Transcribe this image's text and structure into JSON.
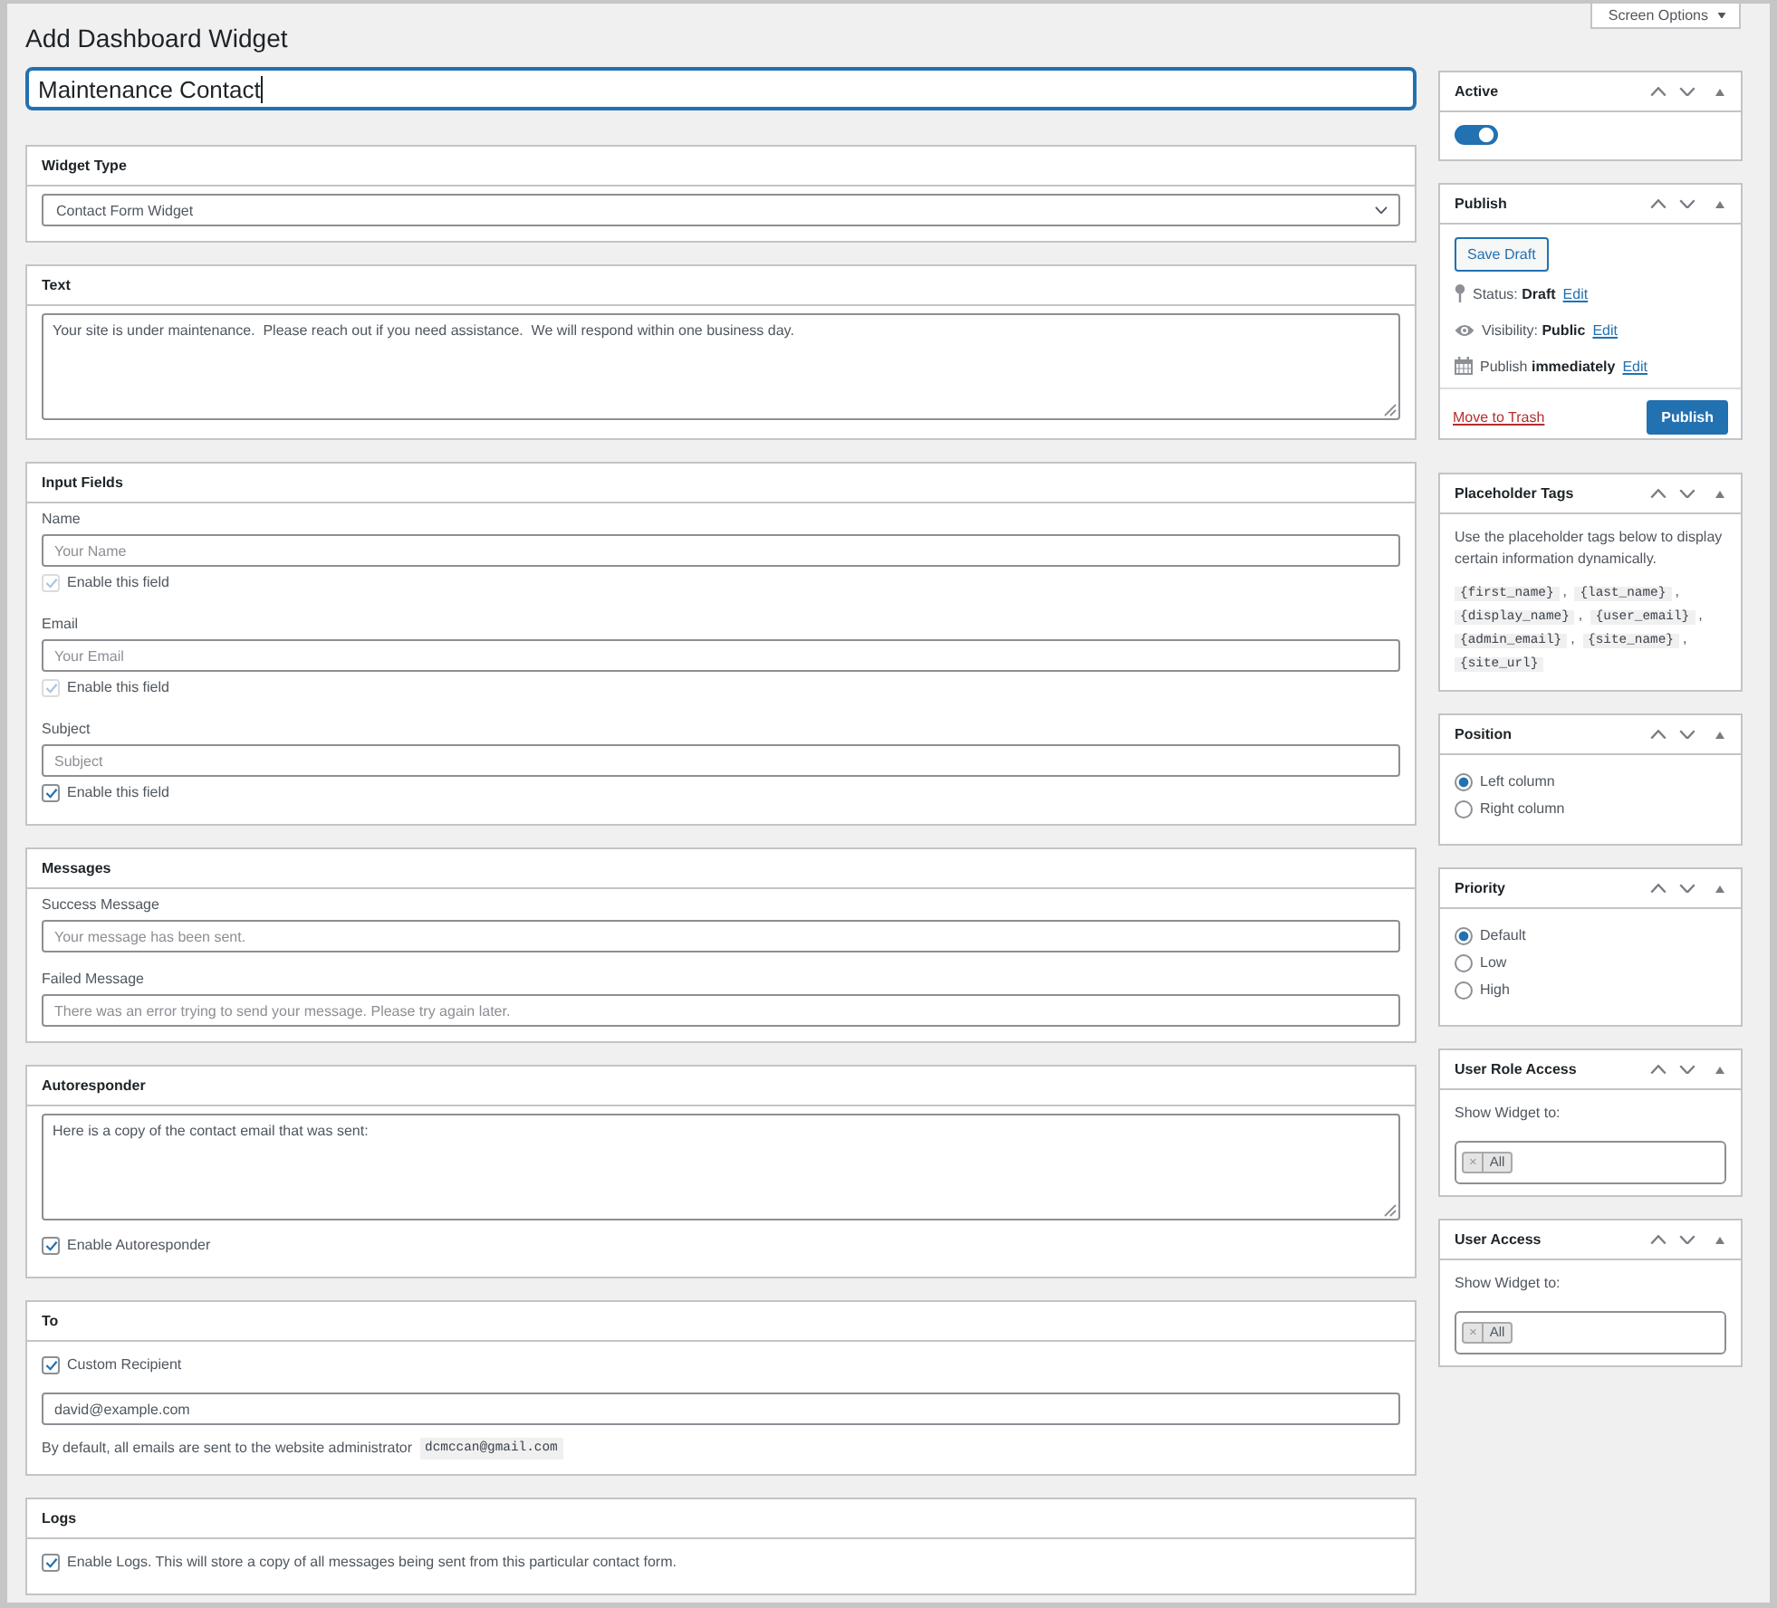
{
  "screen_options": {
    "label": "Screen Options"
  },
  "page_title": "Add Dashboard Widget",
  "title_field": {
    "value": "Maintenance Contact"
  },
  "main_boxes": [
    {
      "title": "Widget Type",
      "items": [
        {
          "kind": "select",
          "value": "Contact Form Widget"
        }
      ]
    },
    {
      "title": "Text",
      "items": [
        {
          "kind": "textarea",
          "value": "Your site is under maintenance.  Please reach out if you need assistance.  We will respond within one business day."
        }
      ]
    },
    {
      "title": "Input Fields",
      "items": [
        {
          "kind": "label",
          "text": "Name"
        },
        {
          "kind": "input",
          "placeholder": "Your Name"
        },
        {
          "kind": "checkbox",
          "label": "Enable this field",
          "checked": true,
          "disabled": true
        },
        {
          "kind": "label",
          "text": "Email"
        },
        {
          "kind": "input",
          "placeholder": "Your Email"
        },
        {
          "kind": "checkbox",
          "label": "Enable this field",
          "checked": true,
          "disabled": true
        },
        {
          "kind": "label",
          "text": "Subject"
        },
        {
          "kind": "input",
          "placeholder": "Subject"
        },
        {
          "kind": "checkbox",
          "label": "Enable this field",
          "checked": true,
          "disabled": false
        }
      ]
    },
    {
      "title": "Messages",
      "items": [
        {
          "kind": "label",
          "text": "Success Message"
        },
        {
          "kind": "input",
          "placeholder": "Your message has been sent."
        },
        {
          "kind": "label",
          "text": "Failed Message"
        },
        {
          "kind": "input",
          "placeholder": "There was an error trying to send your message. Please try again later."
        }
      ]
    },
    {
      "title": "Autoresponder",
      "items": [
        {
          "kind": "textarea",
          "value": "Here is a copy of the contact email that was sent:"
        },
        {
          "kind": "checkbox",
          "label": "Enable Autoresponder",
          "checked": true,
          "disabled": false
        }
      ]
    },
    {
      "title": "To",
      "items": [
        {
          "kind": "checkbox",
          "label": "Custom Recipient",
          "checked": true,
          "disabled": false
        },
        {
          "kind": "input",
          "value": "david@example.com"
        },
        {
          "kind": "note",
          "text": "By default, all emails are sent to the website administrator",
          "code": "dcmccan@gmail.com"
        }
      ]
    },
    {
      "title": "Logs",
      "items": [
        {
          "kind": "checkbox",
          "label": "Enable Logs. This will store a copy of all messages being sent from this particular contact form.",
          "checked": true,
          "disabled": false
        }
      ]
    }
  ],
  "sidebar_boxes": [
    {
      "title": "Active",
      "items": [
        {
          "kind": "toggle",
          "on": true
        }
      ]
    },
    {
      "title": "Publish",
      "items": [
        {
          "kind": "button",
          "label": "Save Draft"
        },
        {
          "kind": "meta",
          "text": "Status: **Draft**",
          "link": "Edit"
        },
        {
          "kind": "meta",
          "text": "Visibility: **Public**",
          "link": "Edit"
        },
        {
          "kind": "meta",
          "text": "Publish **immediately**",
          "link": "Edit"
        },
        {
          "kind": "actions",
          "link": "Move to Trash",
          "button": "Publish"
        }
      ]
    },
    {
      "title": "Placeholder Tags",
      "items": [
        {
          "kind": "paragraph",
          "text": "Use the placeholder tags below to display certain information dynamically."
        },
        {
          "kind": "tags",
          "tags": [
            {
              "code": "{first_name}",
              "after": ","
            },
            {
              "code": "{last_name}",
              "after": ","
            },
            {
              "code": "{display_name}",
              "after": ","
            },
            {
              "code": "{user_email}",
              "after": ","
            },
            {
              "code": "{admin_email}",
              "after": ","
            },
            {
              "code": "{site_name}",
              "after": ","
            },
            {
              "code": "{site_url}"
            }
          ]
        }
      ]
    },
    {
      "title": "Position",
      "items": [
        {
          "kind": "radio",
          "label": "Left column",
          "selected": true
        },
        {
          "kind": "radio",
          "label": "Right column",
          "selected": false
        }
      ]
    },
    {
      "title": "Priority",
      "items": [
        {
          "kind": "radio",
          "label": "Default",
          "selected": true
        },
        {
          "kind": "radio",
          "label": "Low",
          "selected": false
        },
        {
          "kind": "radio",
          "label": "High",
          "selected": false
        }
      ]
    },
    {
      "title": "User Role Access",
      "items": [
        {
          "kind": "paragraph",
          "text": "Show Widget to:"
        },
        {
          "kind": "multiselect",
          "tags": [
            {
              "remove": "×",
              "label": "All"
            }
          ]
        }
      ]
    },
    {
      "title": "User Access",
      "items": [
        {
          "kind": "paragraph",
          "text": "Show Widget to:"
        },
        {
          "kind": "multiselect",
          "tags": [
            {
              "remove": "×",
              "label": "All"
            }
          ]
        }
      ]
    }
  ]
}
